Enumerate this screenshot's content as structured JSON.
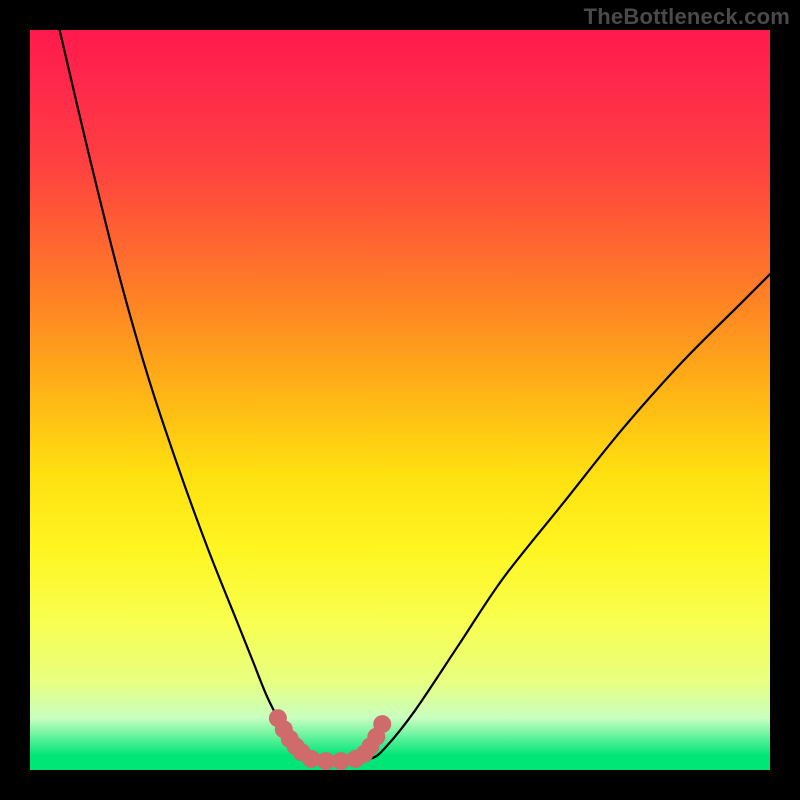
{
  "watermark": "TheBottleneck.com",
  "colors": {
    "background": "#000000",
    "gradient_top": "#ff1a4d",
    "gradient_bottom": "#00e676",
    "curve": "#000000",
    "marker": "#cf6b6b"
  },
  "chart_data": {
    "type": "line",
    "title": "",
    "xlabel": "",
    "ylabel": "",
    "xlim": [
      0,
      100
    ],
    "ylim": [
      0,
      100
    ],
    "grid": false,
    "legend": false,
    "series": [
      {
        "name": "left-branch",
        "x": [
          4,
          8,
          12,
          16,
          20,
          24,
          28,
          30,
          32,
          34,
          35,
          36,
          37
        ],
        "y": [
          100,
          83,
          67,
          53,
          41,
          30,
          20,
          15,
          10,
          6,
          4,
          2.5,
          1.5
        ]
      },
      {
        "name": "valley-floor",
        "x": [
          37,
          40,
          43,
          46
        ],
        "y": [
          1.5,
          1,
          1,
          1.5
        ]
      },
      {
        "name": "right-branch",
        "x": [
          46,
          48,
          52,
          58,
          64,
          72,
          80,
          88,
          96,
          100
        ],
        "y": [
          1.5,
          3,
          8,
          17,
          26,
          36,
          46,
          55,
          63,
          67
        ]
      }
    ],
    "markers": {
      "name": "highlight-band",
      "color": "#cf6b6b",
      "points_x": [
        33.5,
        34.3,
        35.1,
        35.9,
        36.7,
        38.0,
        40.0,
        42.0,
        44.0,
        45.2,
        46.0,
        46.8,
        47.6
      ],
      "points_y": [
        7.0,
        5.5,
        4.2,
        3.2,
        2.4,
        1.5,
        1.2,
        1.2,
        1.5,
        2.2,
        3.2,
        4.5,
        6.2
      ]
    }
  }
}
